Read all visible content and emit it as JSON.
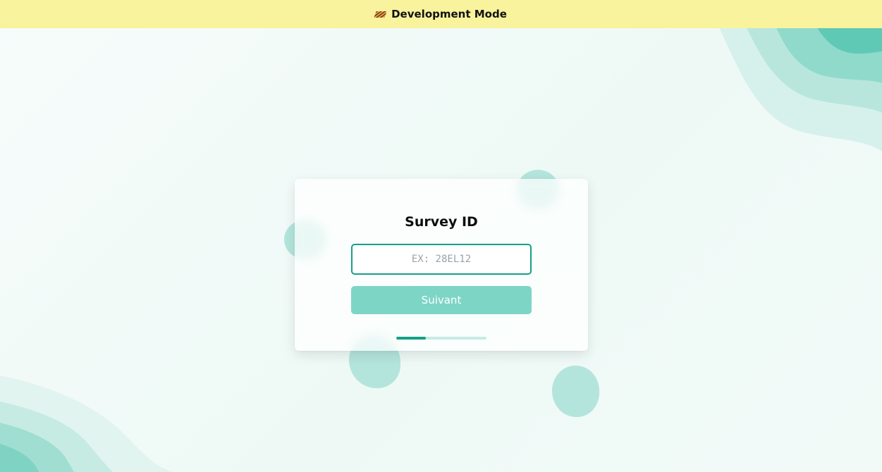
{
  "banner": {
    "label": "Development Mode",
    "icon": "construction-stripes-icon"
  },
  "form": {
    "title": "Survey ID",
    "input_placeholder": "EX: 28EL12",
    "input_value": "",
    "next_button_label": "Suivant"
  },
  "progress": {
    "step_fraction": 0.33
  },
  "colors": {
    "accent": "#14a085",
    "button": "#7dd5c6",
    "banner": "#f8f39c",
    "wave": "#5cc7b4"
  }
}
